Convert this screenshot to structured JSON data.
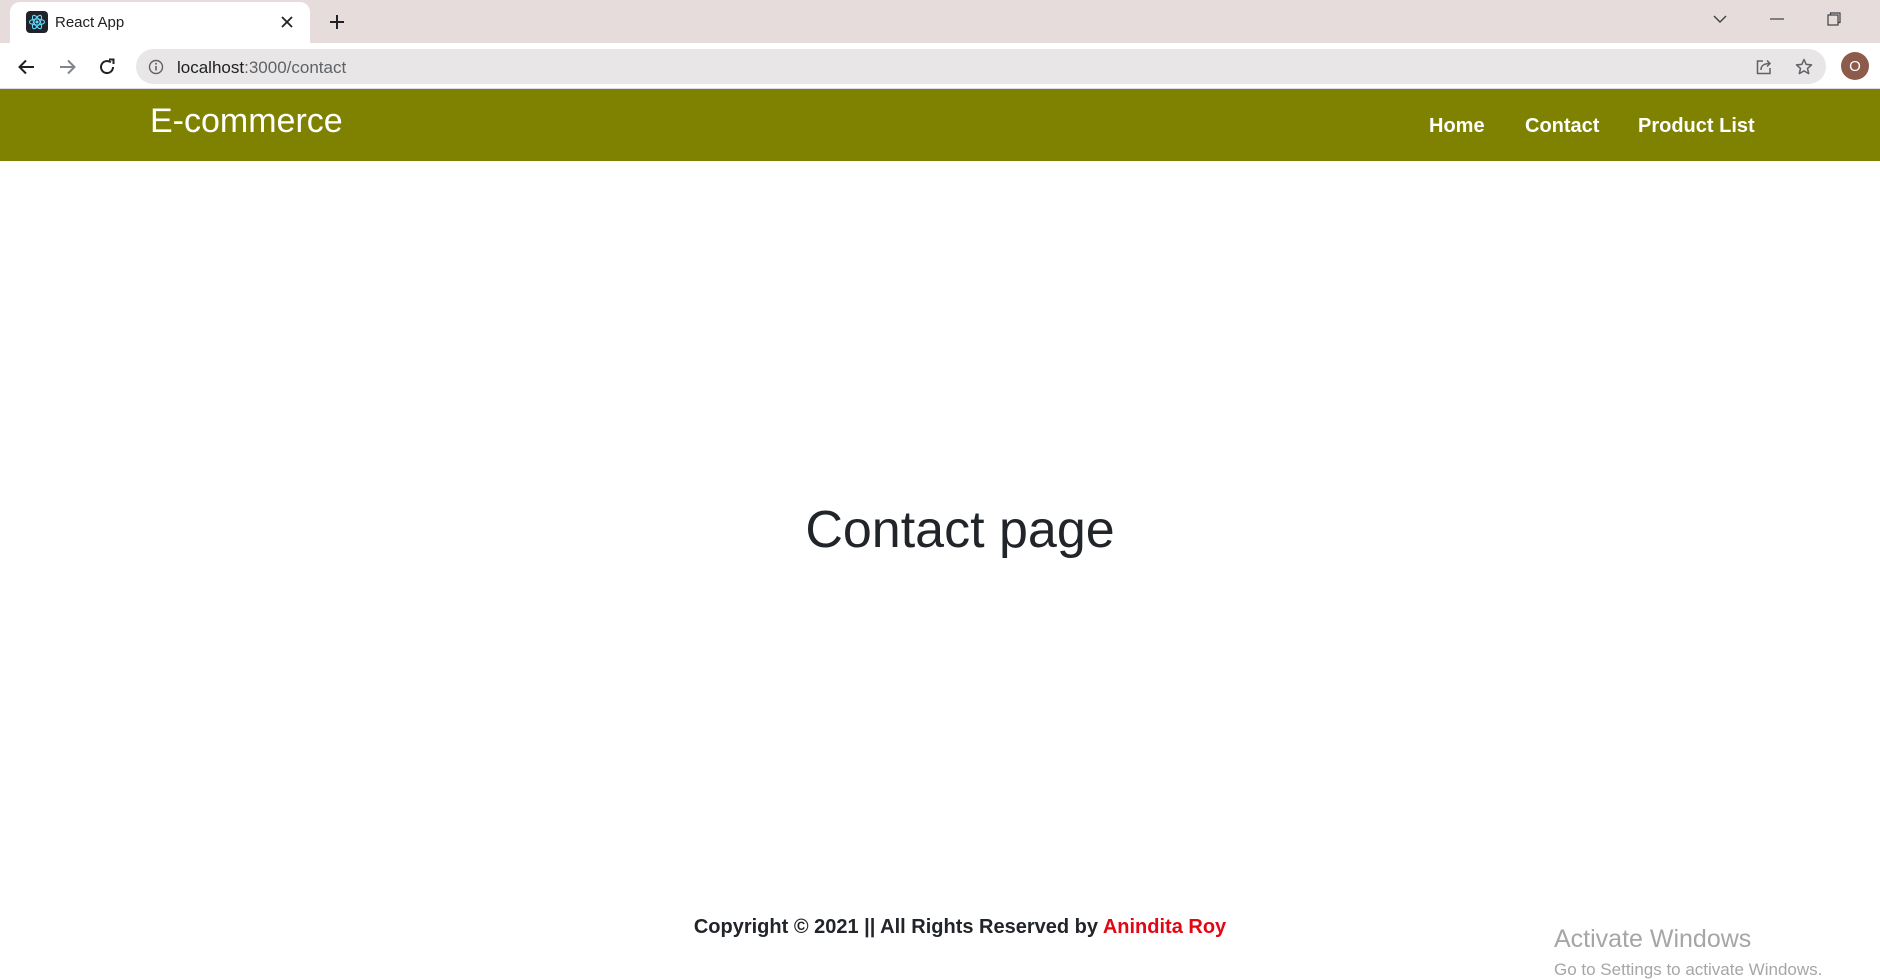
{
  "browser": {
    "tab_title": "React App",
    "url_host": "localhost",
    "url_path": ":3000/contact",
    "profile_initial": "O"
  },
  "site": {
    "brand": "E-commerce",
    "nav": [
      "Home",
      "Contact",
      "Product List"
    ],
    "nav_color": "#7f8100"
  },
  "page": {
    "heading": "Contact page"
  },
  "footer": {
    "prefix": "Copyright © 2021 || All Rights Reserved by ",
    "author": "Anindita Roy",
    "author_color": "#e30613"
  },
  "overlay": {
    "watermark_line1": "Activate Windows",
    "watermark_line2": "Go to Settings to activate Windows."
  },
  "icons": {
    "favicon": "react-icon",
    "tab_close": "close-icon",
    "new_tab": "plus-icon",
    "tab_search": "chevron-down-icon",
    "minimize": "minimize-icon",
    "restore": "restore-icon",
    "back": "arrow-left-icon",
    "forward": "arrow-right-icon",
    "reload": "reload-icon",
    "site_info": "info-icon",
    "share": "share-icon",
    "bookmark": "star-icon"
  }
}
